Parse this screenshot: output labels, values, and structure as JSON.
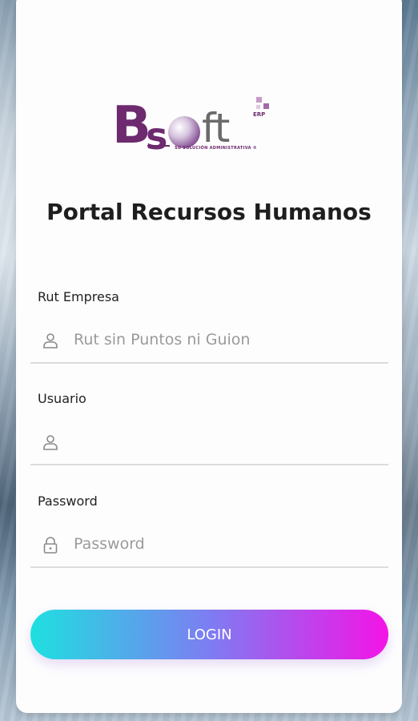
{
  "logo": {
    "brand_b": "B",
    "brand_s": "s",
    "brand_ft": "ft",
    "badge": "ERP",
    "tagline": "SU SOLUCIÓN ADMINISTRATIVA ®"
  },
  "page": {
    "title": "Portal Recursos Humanos"
  },
  "form": {
    "rut": {
      "label": "Rut Empresa",
      "placeholder": "Rut sin Puntos ni Guion",
      "value": "",
      "icon": "user-icon"
    },
    "usuario": {
      "label": "Usuario",
      "placeholder": "",
      "value": "",
      "icon": "user-icon"
    },
    "password": {
      "label": "Password",
      "placeholder": "Password",
      "value": "",
      "icon": "lock-icon"
    }
  },
  "login_button": {
    "label": "LOGIN"
  },
  "colors": {
    "brand_purple": "#6d2a6e",
    "button_start": "#1ee0e0",
    "button_end": "#f413e6"
  }
}
